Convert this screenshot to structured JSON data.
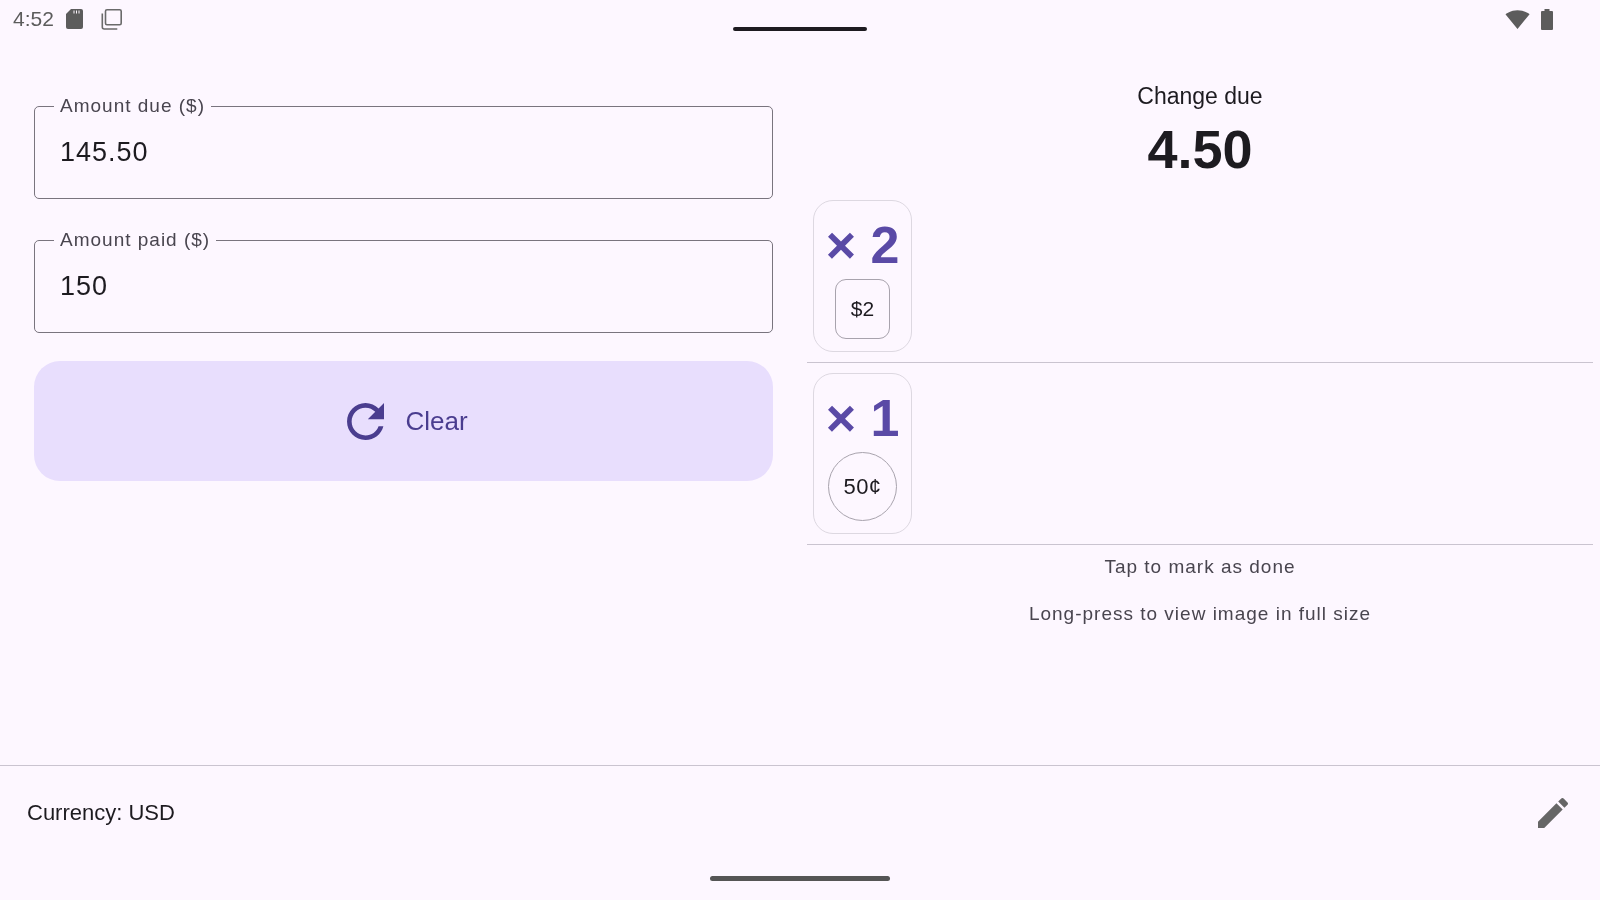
{
  "status_bar": {
    "time": "4:52"
  },
  "fields": [
    {
      "label": "Amount due ($)",
      "value": "145.50"
    },
    {
      "label": "Amount paid ($)",
      "value": "150"
    }
  ],
  "clear_button": {
    "label": "Clear"
  },
  "change": {
    "label": "Change due",
    "amount": "4.50"
  },
  "denominations": [
    {
      "count": "× 2",
      "label": "$2",
      "kind": "note"
    },
    {
      "count": "× 1",
      "label": "50¢",
      "kind": "coin"
    }
  ],
  "hints": [
    "Tap to mark as done",
    "Long-press to view image in full size"
  ],
  "footer": {
    "currency": "Currency: USD"
  }
}
